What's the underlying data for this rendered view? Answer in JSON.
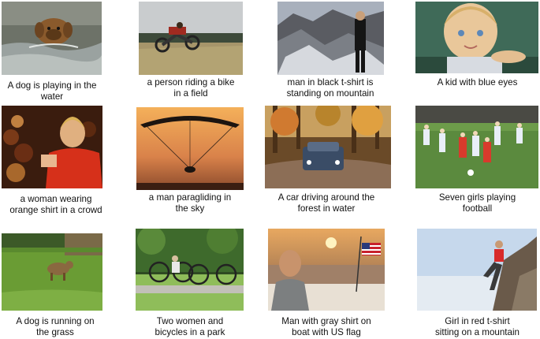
{
  "grid": {
    "items": [
      {
        "caption": "A dog is playing in the\nwater",
        "subject": "dog-swimming-photo"
      },
      {
        "caption": "a person riding a bike\nin a field",
        "subject": "bike-field-photo"
      },
      {
        "caption": "man in black t-shirt is\nstanding on mountain",
        "subject": "mountain-man-photo"
      },
      {
        "caption": "A kid with blue eyes",
        "subject": "kid-blue-eyes-photo"
      },
      {
        "caption": "a woman wearing\norange shirt in a crowd",
        "subject": "woman-crowd-photo"
      },
      {
        "caption": "a man paragliding in\nthe sky",
        "subject": "paraglider-photo"
      },
      {
        "caption": "A car driving around the\nforest in water",
        "subject": "car-forest-photo"
      },
      {
        "caption": "Seven girls playing\nfootball",
        "subject": "girls-football-photo"
      },
      {
        "caption": "A dog is running on\nthe grass",
        "subject": "dog-grass-photo"
      },
      {
        "caption": "Two women and\nbicycles in a park",
        "subject": "bicycles-park-photo"
      },
      {
        "caption": "Man with gray shirt on\nboat with US flag",
        "subject": "boat-flag-photo"
      },
      {
        "caption": "Girl in red t-shirt\nsitting on a mountain",
        "subject": "girl-mountain-photo"
      }
    ]
  }
}
